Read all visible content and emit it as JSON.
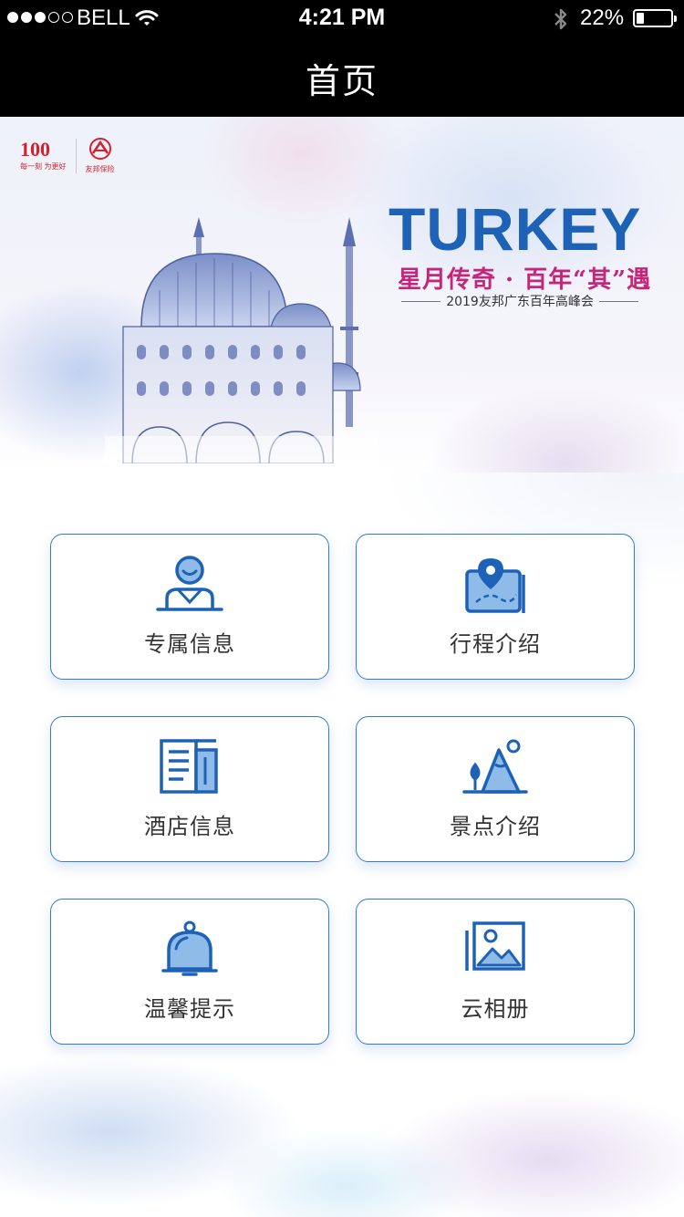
{
  "status_bar": {
    "carrier": "BELL",
    "time": "4:21 PM",
    "battery_percent": "22%",
    "battery_level": 0.22,
    "signal_bars_filled": 3,
    "signal_bars_total": 5
  },
  "nav": {
    "title": "首页"
  },
  "banner": {
    "logo_100": "100",
    "logo_100_caption": "每一刻 为更好",
    "logo_aia_caption": "友邦保险",
    "title": "TURKEY",
    "slogan": "星月传奇 · 百年“其”遇",
    "event": "2019友邦广东百年高峰会"
  },
  "menu": [
    {
      "label": "专属信息",
      "icon": "user-profile-icon"
    },
    {
      "label": "行程介绍",
      "icon": "map-pin-icon"
    },
    {
      "label": "酒店信息",
      "icon": "hotel-building-icon"
    },
    {
      "label": "景点介绍",
      "icon": "mountain-scenery-icon"
    },
    {
      "label": "温馨提示",
      "icon": "bell-icon"
    },
    {
      "label": "云相册",
      "icon": "photo-album-icon"
    }
  ],
  "colors": {
    "accent": "#2f7ccd",
    "icon_blue": "#1d62b6",
    "icon_light": "#8fbbe8",
    "title_blue": "#1d62b6",
    "slogan_pink": "#c4267a"
  }
}
